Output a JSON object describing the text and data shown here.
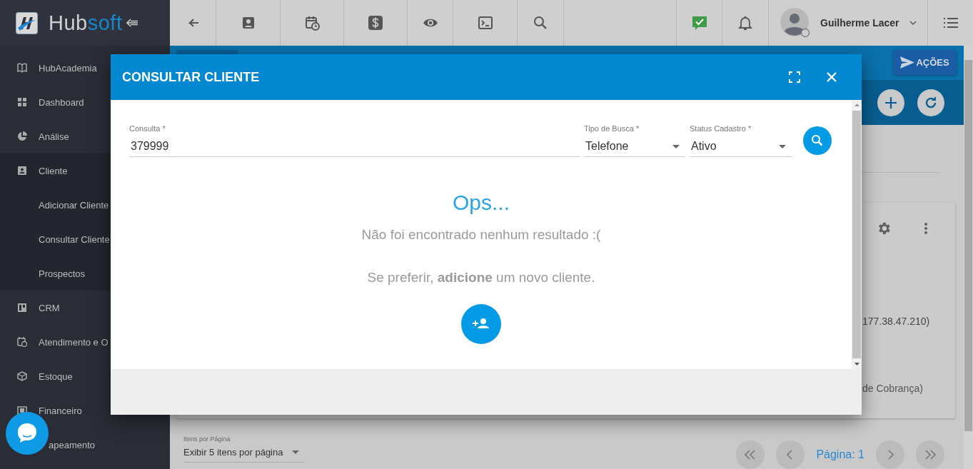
{
  "topbar": {
    "logo": {
      "text": "Hub",
      "accent": "soft"
    },
    "user": {
      "name": "Guilherme Lacer"
    }
  },
  "sidebar": {
    "items": [
      {
        "label": "HubAcademia"
      },
      {
        "label": "Dashboard"
      },
      {
        "label": "Análise"
      },
      {
        "label": "Cliente",
        "children": [
          {
            "label": "Adicionar Cliente"
          },
          {
            "label": "Consultar Cliente"
          },
          {
            "label": "Prospectos"
          }
        ]
      },
      {
        "label": "CRM"
      },
      {
        "label": "Atendimento e O"
      },
      {
        "label": "Estoque"
      },
      {
        "label": "Financeiro"
      },
      {
        "label": "apeamento"
      }
    ]
  },
  "page": {
    "actions_button": "AÇÕES",
    "card": {
      "texts": [
        "177.38.47.210)",
        "de Cobrança)"
      ]
    },
    "pagination": {
      "per_page_label": "Itens por Página",
      "per_page_value": "Exibir 5 itens por página",
      "page_label": "Página: 1"
    }
  },
  "dialog": {
    "title": "CONSULTAR CLIENTE",
    "fields": [
      {
        "kind": "text",
        "label": "Consulta *",
        "value": "379999"
      },
      {
        "kind": "select",
        "label": "Tipo de Busca *",
        "value": "Telefone"
      },
      {
        "kind": "select",
        "label": "Status Cadastro *",
        "value": "Ativo"
      }
    ],
    "empty_state": {
      "heading": "Ops...",
      "message": "Não foi encontrado nenhum resultado :(",
      "hint": "Se preferir, **adicione** um novo cliente."
    }
  }
}
